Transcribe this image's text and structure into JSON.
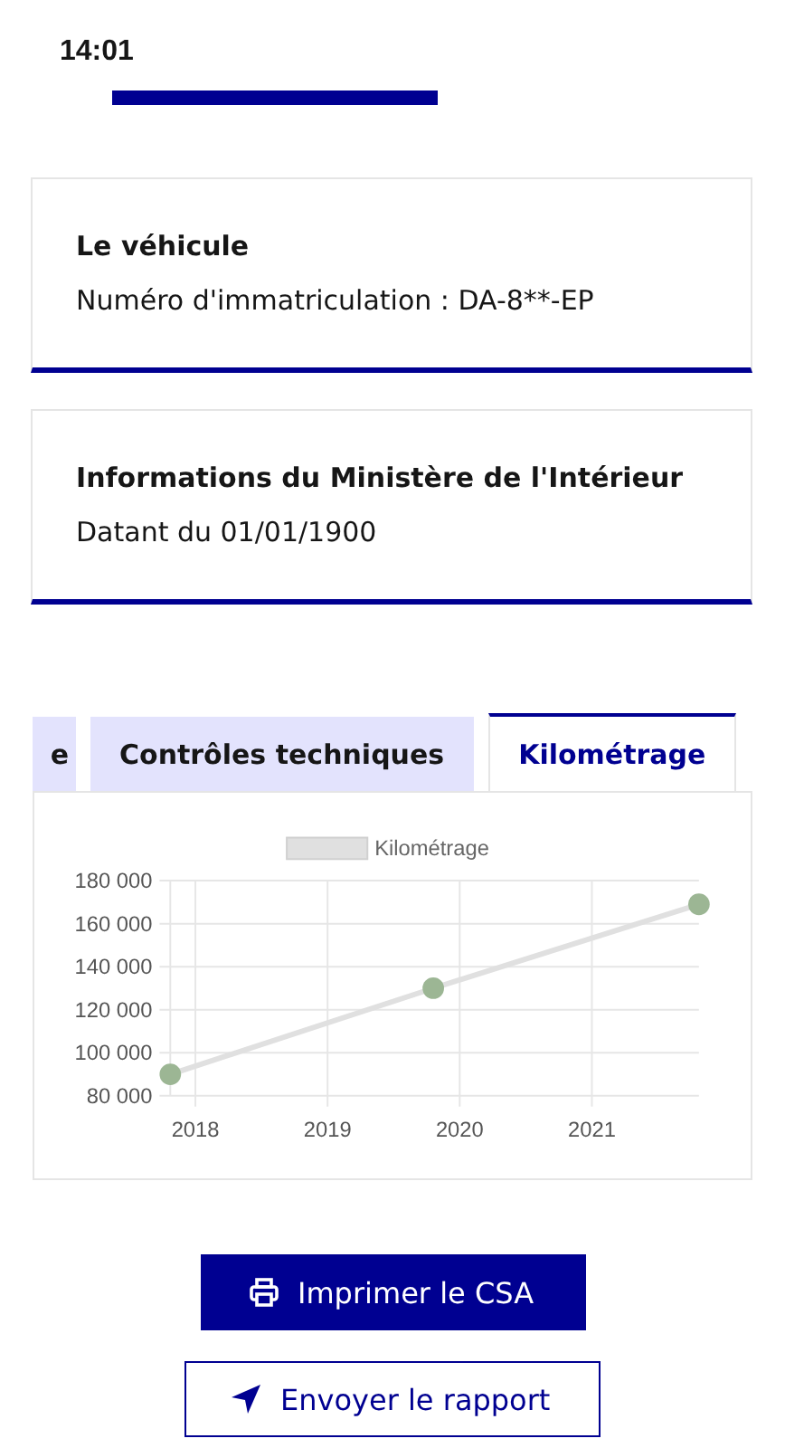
{
  "status_bar": {
    "time": "14:01"
  },
  "cards": [
    {
      "title": "Le véhicule",
      "text": "Numéro d'immatriculation : DA-8**-EP"
    },
    {
      "title": "Informations du Ministère de l'Intérieur",
      "text": "Datant du 01/01/1900"
    }
  ],
  "tabs": [
    {
      "label": "e",
      "selected": false
    },
    {
      "label": "Contrôles techniques",
      "selected": false
    },
    {
      "label": "Kilométrage",
      "selected": true
    }
  ],
  "chart_data": {
    "type": "line",
    "x": [
      2017.81,
      2019.8,
      2021.81
    ],
    "series": [
      {
        "name": "Kilométrage",
        "color": "#e0e0e0",
        "marker": true,
        "values": [
          90000,
          130000,
          169000
        ]
      }
    ],
    "grid": true,
    "xlim": [
      2017.81,
      2021.81
    ],
    "ylim": [
      80000,
      180000
    ],
    "xticks": [
      2018,
      2019,
      2020,
      2021
    ],
    "yticks": [
      {
        "value": 80000,
        "label": "80 000"
      },
      {
        "value": 100000,
        "label": "100 000"
      },
      {
        "value": 120000,
        "label": "120 000"
      },
      {
        "value": 140000,
        "label": "140 000"
      },
      {
        "value": 160000,
        "label": "160 000"
      },
      {
        "value": 180000,
        "label": "180 000"
      }
    ]
  },
  "buttons": [
    {
      "label": "Imprimer le CSA",
      "kind": "primary"
    },
    {
      "label": "Envoyer le rapport",
      "kind": "secondary"
    }
  ]
}
